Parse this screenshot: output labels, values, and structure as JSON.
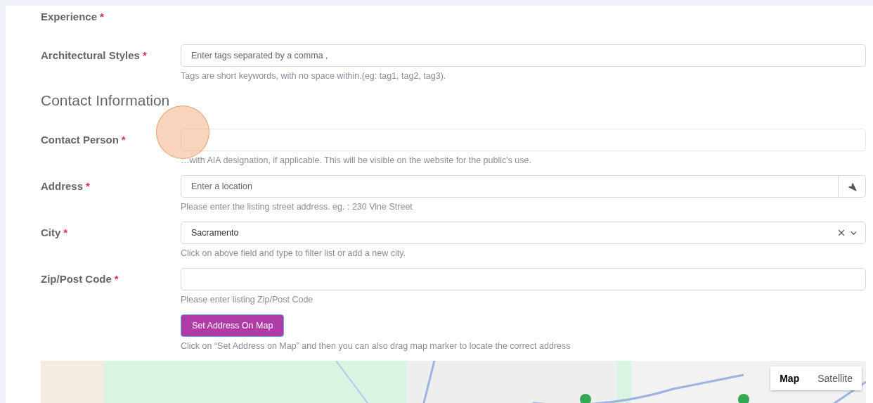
{
  "fields": [
    {
      "kind": "label_only",
      "label": "Experience",
      "required_mark": "*"
    },
    {
      "kind": "text",
      "label": "Architectural Styles",
      "required_mark": "*",
      "placeholder": "Enter tags separated by a comma ,",
      "hint": "Tags are short keywords, with no space within.(eg: tag1, tag2, tag3)."
    }
  ],
  "section_title": "Contact Information",
  "contact_fields": [
    {
      "kind": "text",
      "label": "Contact Person",
      "required_mark": "*",
      "hint": "…with AIA designation, if applicable. This will be visible on the website for the public's use.",
      "focused": true
    },
    {
      "kind": "location",
      "label": "Address",
      "required_mark": "*",
      "placeholder": "Enter a location",
      "hint": "Please enter the listing street address. eg. : 230 Vine Street"
    },
    {
      "kind": "select",
      "label": "City",
      "required_mark": "*",
      "value": "Sacramento",
      "hint": "Click on above field and type to filter list or add a new city."
    },
    {
      "kind": "text",
      "label": "Zip/Post Code",
      "required_mark": "*",
      "hint": "Please enter listing Zip/Post Code"
    }
  ],
  "map_button": {
    "label": "Set Address On Map",
    "hint": "Click on “Set Address on Map” and then you can also drag map marker to locate the correct address"
  },
  "map": {
    "kind": "picture",
    "types": [
      {
        "label": "Map",
        "selected": true
      },
      {
        "label": "Satellite",
        "selected": false
      }
    ]
  }
}
